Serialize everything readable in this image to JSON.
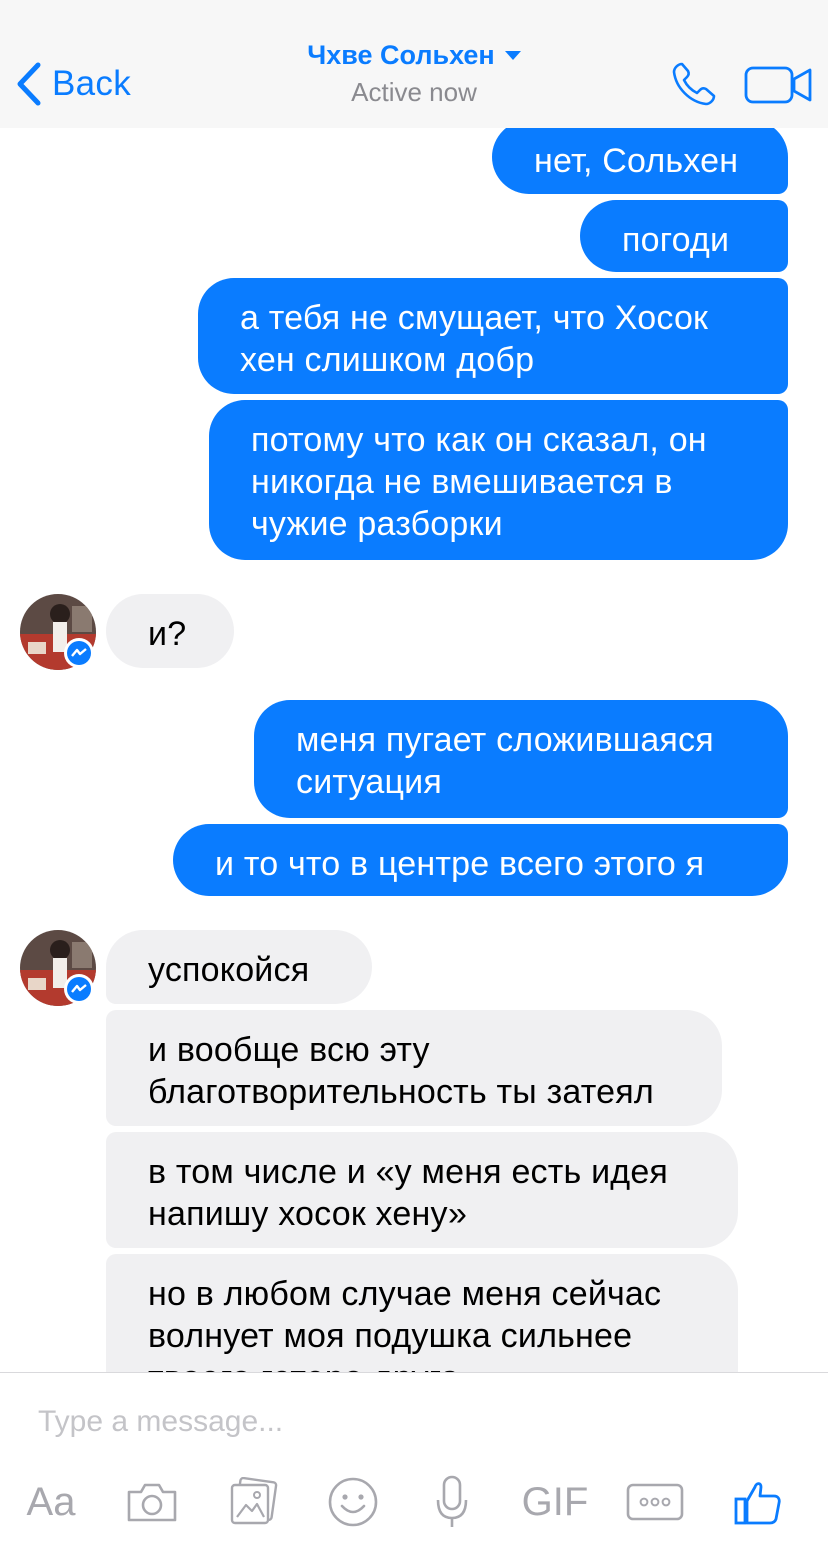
{
  "header": {
    "back_label": "Back",
    "contact_name": "Чхве Сольхен",
    "status": "Active now"
  },
  "messages": [
    {
      "dir": "out",
      "text": "нет, Сольхен"
    },
    {
      "dir": "out",
      "text": "погоди"
    },
    {
      "dir": "out",
      "text": "а тебя не смущает, что Хосок хен слишком добр"
    },
    {
      "dir": "out",
      "text": "потому что как он сказал, он никогда не вмешивается в чужие разборки"
    },
    {
      "dir": "in",
      "text": "и?"
    },
    {
      "dir": "out",
      "text": "меня пугает сложившаяся ситуация"
    },
    {
      "dir": "out",
      "text": "и то что в центре всего этого я"
    },
    {
      "dir": "in",
      "text": "успокойся"
    },
    {
      "dir": "in",
      "text": "и вообще всю эту благотворительность ты затеял"
    },
    {
      "dir": "in",
      "text": "в том числе и «у меня есть идея напишу хосок хену»"
    },
    {
      "dir": "in",
      "text": "но в любом случае меня сейчас волнует моя подушка сильнее твоего гетеро друга"
    }
  ],
  "composer": {
    "placeholder": "Type a message...",
    "tools": {
      "text_label": "Aa",
      "gif_label": "GIF"
    }
  },
  "colors": {
    "accent": "#0a7cff",
    "incoming_bubble": "#f0f0f2",
    "header_bg": "#f7f7f7"
  },
  "icons": [
    "chevron-left-icon",
    "phone-icon",
    "video-camera-icon",
    "messenger-badge-icon",
    "camera-icon",
    "photo-gallery-icon",
    "emoji-icon",
    "microphone-icon",
    "more-icon",
    "thumbs-up-icon"
  ]
}
